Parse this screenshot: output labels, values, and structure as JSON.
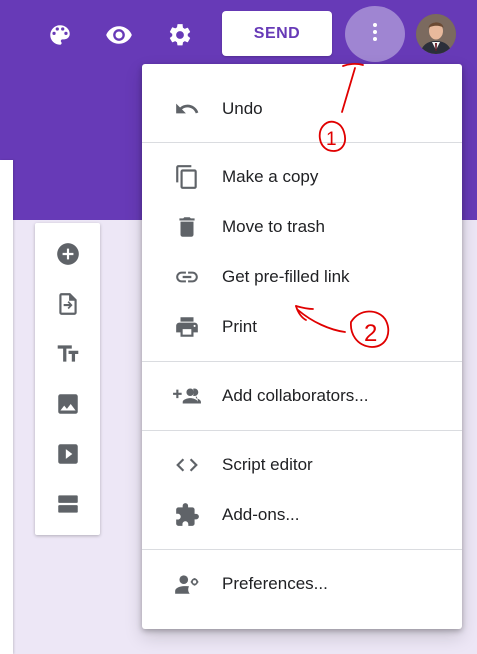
{
  "toolbar": {
    "icons": [
      "palette-icon",
      "eye-icon",
      "gear-icon",
      "more-vert-icon"
    ],
    "send_label": "SEND"
  },
  "menu": {
    "items": [
      {
        "label": "Undo",
        "icon": "undo-icon"
      },
      {
        "label": "Make a copy",
        "icon": "copy-icon"
      },
      {
        "label": "Move to trash",
        "icon": "trash-icon"
      },
      {
        "label": "Get pre-filled link",
        "icon": "link-icon"
      },
      {
        "label": "Print",
        "icon": "print-icon"
      },
      {
        "label": "Add collaborators...",
        "icon": "add-people-icon"
      },
      {
        "label": "Script editor",
        "icon": "code-icon"
      },
      {
        "label": "Add-ons...",
        "icon": "puzzle-icon"
      },
      {
        "label": "Preferences...",
        "icon": "person-settings-icon"
      }
    ]
  },
  "side_tools": [
    "add-question-icon",
    "import-questions-icon",
    "title-text-icon",
    "image-icon",
    "video-icon",
    "section-icon"
  ],
  "annotations": {
    "marker_1": "1",
    "marker_2": "2",
    "color": "#e00000"
  },
  "colors": {
    "header_purple": "#673ab7",
    "page_background": "#ede7f6",
    "icon_gray": "#5f6368"
  }
}
